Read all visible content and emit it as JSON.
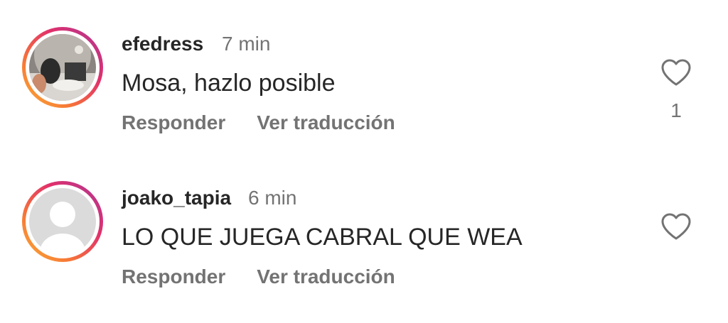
{
  "comments": [
    {
      "username": "efedress",
      "time": "7 min",
      "text": "Mosa, hazlo posible",
      "reply_label": "Responder",
      "translate_label": "Ver traducción",
      "likes": "1",
      "avatar": "photo-avatar",
      "like_icon": "heart-outline-icon"
    },
    {
      "username": "joako_tapia",
      "time": "6 min",
      "text": "LO QUE JUEGA CABRAL QUE WEA",
      "reply_label": "Responder",
      "translate_label": "Ver traducción",
      "likes": "",
      "avatar": "default-avatar",
      "like_icon": "heart-outline-icon"
    }
  ],
  "colors": {
    "text_primary": "#262626",
    "text_secondary": "#737373",
    "story_ring_start": "#f9b233",
    "story_ring_end": "#c13584"
  }
}
